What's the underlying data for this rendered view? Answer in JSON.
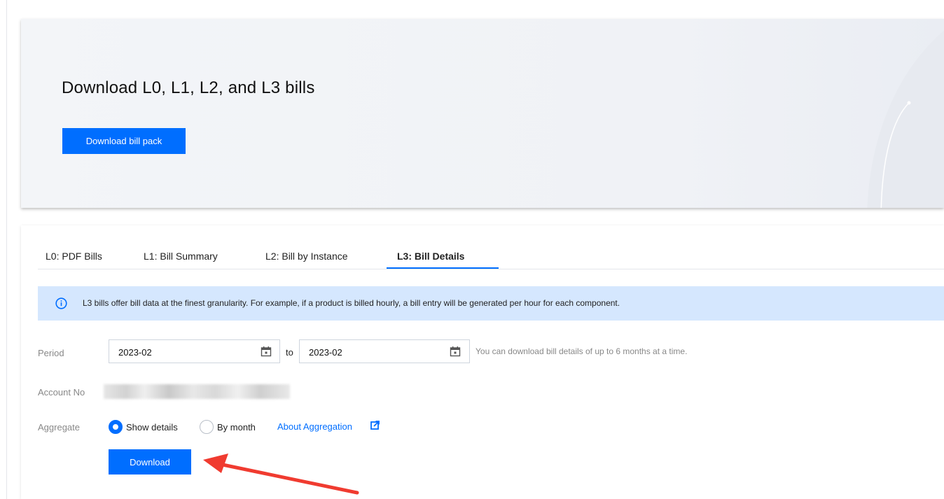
{
  "hero": {
    "title": "Download L0, L1, L2, and L3 bills",
    "button_label": "Download bill pack"
  },
  "tabs": [
    {
      "label": "L0: PDF Bills",
      "active": false
    },
    {
      "label": "L1: Bill Summary",
      "active": false
    },
    {
      "label": "L2: Bill by Instance",
      "active": false
    },
    {
      "label": "L3: Bill Details",
      "active": true
    }
  ],
  "notice": {
    "icon": "info-icon",
    "text": "L3 bills offer bill data at the finest granularity. For example, if a product is billed hourly, a bill entry will be generated per hour for each component."
  },
  "form": {
    "period_label": "Period",
    "start_month": "2023-02",
    "to_label": "to",
    "end_month": "2023-02",
    "period_hint": "You can download bill details of up to 6 months at a time.",
    "account_label": "Account No",
    "aggregate_label": "Aggregate",
    "aggregate_options": [
      {
        "label": "Show details",
        "checked": true
      },
      {
        "label": "By month",
        "checked": false
      }
    ],
    "about_link": "About Aggregation",
    "download_label": "Download"
  },
  "colors": {
    "accent": "#006eff",
    "notice_bg": "#d5e7fe",
    "annotation_arrow": "#f03b30"
  }
}
